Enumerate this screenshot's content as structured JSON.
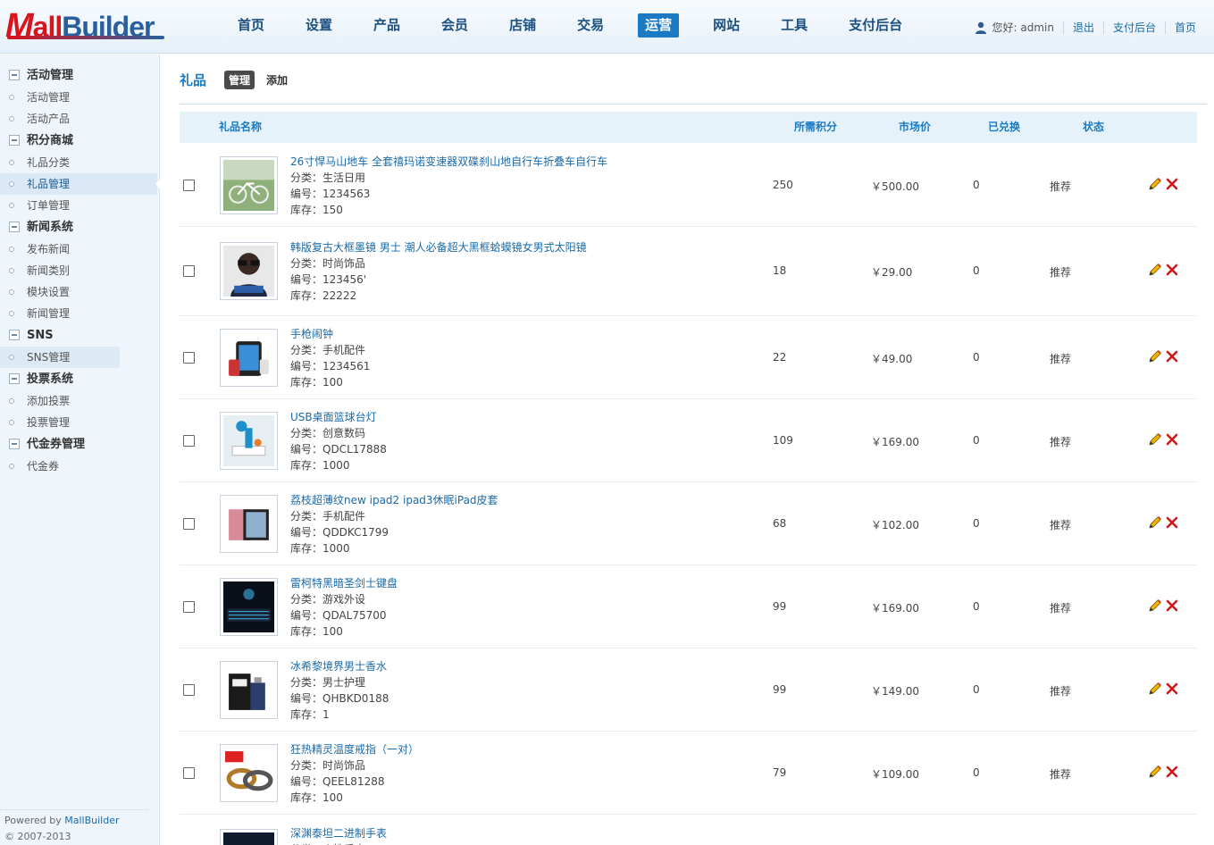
{
  "header": {
    "logo": {
      "m": "M",
      "a": "all",
      "b": "Builder"
    },
    "nav": [
      "首页",
      "设置",
      "产品",
      "会员",
      "店铺",
      "交易",
      "运营",
      "网站",
      "工具",
      "支付后台"
    ],
    "active_nav": "运营",
    "greeting": "您好: admin",
    "links": [
      "退出",
      "支付后台",
      "首页"
    ]
  },
  "sidebar": {
    "groups": [
      {
        "title": "活动管理",
        "items": [
          "活动管理",
          "活动产品"
        ]
      },
      {
        "title": "积分商城",
        "items": [
          "礼品分类",
          "礼品管理",
          "订单管理"
        ]
      },
      {
        "title": "新闻系统",
        "items": [
          "发布新闻",
          "新闻类别",
          "模块设置",
          "新闻管理"
        ]
      },
      {
        "title": "SNS",
        "items": [
          "SNS管理"
        ]
      },
      {
        "title": "投票系统",
        "items": [
          "添加投票",
          "投票管理"
        ]
      },
      {
        "title": "代金券管理",
        "items": [
          "代金券"
        ]
      }
    ],
    "active_item": "礼品管理",
    "footer": {
      "powered": "Powered by ",
      "brand": "MallBuilder",
      "copyright": "© 2007-2013"
    }
  },
  "page": {
    "title": "礼品",
    "tabs": [
      "管理",
      "添加"
    ],
    "active_tab": "管理"
  },
  "table": {
    "columns": [
      "礼品名称",
      "所需积分",
      "市场价",
      "已兑换",
      "状态"
    ],
    "rows": [
      {
        "name": "26寸悍马山地车 全套禧玛诺变速器双碟刹山地自行车折叠车自行车",
        "category": "分类：生活日用",
        "code": "编号：1234563",
        "stock": "库存：150",
        "points": "250",
        "price": "￥500.00",
        "exchanged": "0",
        "status": "推荐",
        "thumb": "bike"
      },
      {
        "name": "韩版复古大框墨镜 男士 潮人必备超大黑框蛤蟆镜女男式太阳镜",
        "category": "分类：时尚饰品",
        "code": "编号：123456'",
        "stock": "库存：22222",
        "points": "18",
        "price": "￥29.00",
        "exchanged": "0",
        "status": "推荐",
        "thumb": "sunglasses"
      },
      {
        "name": "手枪闹钟",
        "category": "分类：手机配件",
        "code": "编号：1234561",
        "stock": "库存：100",
        "points": "22",
        "price": "￥49.00",
        "exchanged": "0",
        "status": "推荐",
        "thumb": "phone"
      },
      {
        "name": "USB桌面篮球台灯",
        "category": "分类：创意数码",
        "code": "编号：QDCL17888",
        "stock": "库存：1000",
        "points": "109",
        "price": "￥169.00",
        "exchanged": "0",
        "status": "推荐",
        "thumb": "lamp"
      },
      {
        "name": "荔枝超薄纹new ipad2 ipad3休眠iPad皮套",
        "category": "分类：手机配件",
        "code": "编号：QDDKC1799",
        "stock": "库存：1000",
        "points": "68",
        "price": "￥102.00",
        "exchanged": "0",
        "status": "推荐",
        "thumb": "ipad"
      },
      {
        "name": "雷柯特黑暗圣剑士键盘",
        "category": "分类：游戏外设",
        "code": "编号：QDAL75700",
        "stock": "库存：100",
        "points": "99",
        "price": "￥169.00",
        "exchanged": "0",
        "status": "推荐",
        "thumb": "keyboard"
      },
      {
        "name": "冰希黎境界男士香水",
        "category": "分类：男士护理",
        "code": "编号：QHBKD0188",
        "stock": "库存：1",
        "points": "99",
        "price": "￥149.00",
        "exchanged": "0",
        "status": "推荐",
        "thumb": "perfume"
      },
      {
        "name": "狂热精灵温度戒指（一对）",
        "category": "分类：时尚饰品",
        "code": "编号：QEEL81288",
        "stock": "库存：100",
        "points": "79",
        "price": "￥109.00",
        "exchanged": "0",
        "status": "推荐",
        "thumb": "rings"
      },
      {
        "name": "深渊泰坦二进制手表",
        "category": "分类：个性手表",
        "code": "",
        "stock": "",
        "points": "",
        "price": "",
        "exchanged": "",
        "status": "",
        "thumb": "watch"
      }
    ]
  }
}
